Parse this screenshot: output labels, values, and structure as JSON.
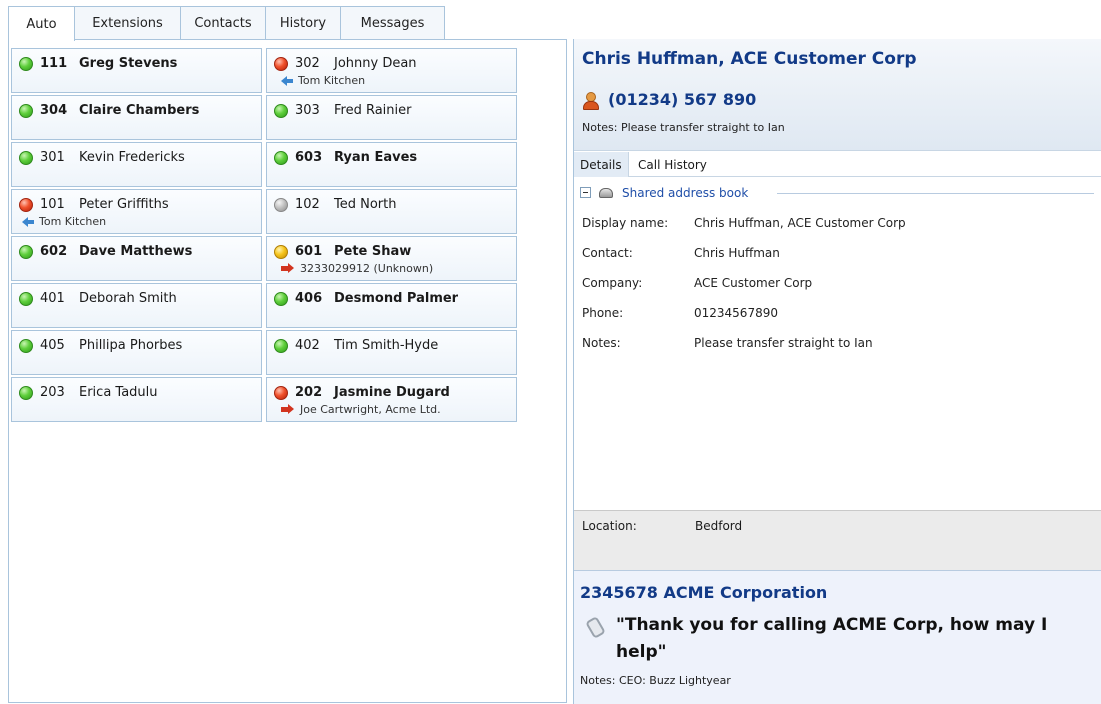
{
  "tabs": [
    {
      "label": "Auto",
      "active": true,
      "w": 67
    },
    {
      "label": "Extensions",
      "active": false,
      "w": 107
    },
    {
      "label": "Contacts",
      "active": false,
      "w": 86
    },
    {
      "label": "History",
      "active": false,
      "w": 76
    },
    {
      "label": "Messages",
      "active": false,
      "w": 105
    }
  ],
  "extensions": [
    {
      "num": "111",
      "name": "Greg Stevens",
      "status": "green",
      "bold": true
    },
    {
      "num": "302",
      "name": "Johnny Dean",
      "status": "red",
      "bold": false,
      "sub": "Tom Kitchen",
      "sub_dir": "incoming"
    },
    {
      "num": "304",
      "name": "Claire Chambers",
      "status": "green",
      "bold": true
    },
    {
      "num": "303",
      "name": "Fred Rainier",
      "status": "green",
      "bold": false
    },
    {
      "num": "301",
      "name": "Kevin Fredericks",
      "status": "green",
      "bold": false
    },
    {
      "num": "603",
      "name": "Ryan Eaves",
      "status": "green",
      "bold": true
    },
    {
      "num": "101",
      "name": "Peter Griffiths",
      "status": "red",
      "bold": false,
      "sub": "Tom Kitchen",
      "sub_dir": "incoming"
    },
    {
      "num": "102",
      "name": "Ted North",
      "status": "grey",
      "bold": false
    },
    {
      "num": "602",
      "name": "Dave Matthews",
      "status": "green",
      "bold": true
    },
    {
      "num": "601",
      "name": "Pete Shaw",
      "status": "yellow",
      "bold": true,
      "sub": "3233029912  (Unknown)",
      "sub_dir": "outgoing"
    },
    {
      "num": "401",
      "name": "Deborah Smith",
      "status": "green",
      "bold": false
    },
    {
      "num": "406",
      "name": "Desmond Palmer",
      "status": "green",
      "bold": true
    },
    {
      "num": "405",
      "name": "Phillipa Phorbes",
      "status": "green",
      "bold": false
    },
    {
      "num": "402",
      "name": "Tim Smith-Hyde",
      "status": "green",
      "bold": false
    },
    {
      "num": "203",
      "name": "Erica Tadulu",
      "status": "green",
      "bold": false
    },
    {
      "num": "202",
      "name": "Jasmine Dugard",
      "status": "red",
      "bold": true,
      "sub": "Joe Cartwright, Acme Ltd.",
      "sub_dir": "outgoing"
    }
  ],
  "contact": {
    "title": "Chris Huffman, ACE Customer Corp",
    "phone": "(01234) 567 890",
    "notes": "Notes: Please transfer straight to Ian",
    "subtabs": [
      "Details",
      "Call History"
    ],
    "group_label": "Shared address book",
    "details": [
      {
        "k": "Display name:",
        "v": "Chris Huffman, ACE Customer Corp"
      },
      {
        "k": "Contact:",
        "v": "Chris Huffman"
      },
      {
        "k": "Company:",
        "v": "ACE Customer Corp"
      },
      {
        "k": "Phone:",
        "v": "01234567890"
      },
      {
        "k": "Notes:",
        "v": "Please transfer straight to Ian"
      }
    ],
    "location_label": "Location:",
    "location_value": "Bedford"
  },
  "called": {
    "title": "2345678  ACME Corporation",
    "greeting": "\"Thank you for calling ACME Corp, how may I help\"",
    "notes": "Notes: CEO: Buzz Lightyear"
  },
  "colors": {
    "accent": "#123a87",
    "border": "#a9c4dc",
    "link": "#1f4ea8"
  }
}
